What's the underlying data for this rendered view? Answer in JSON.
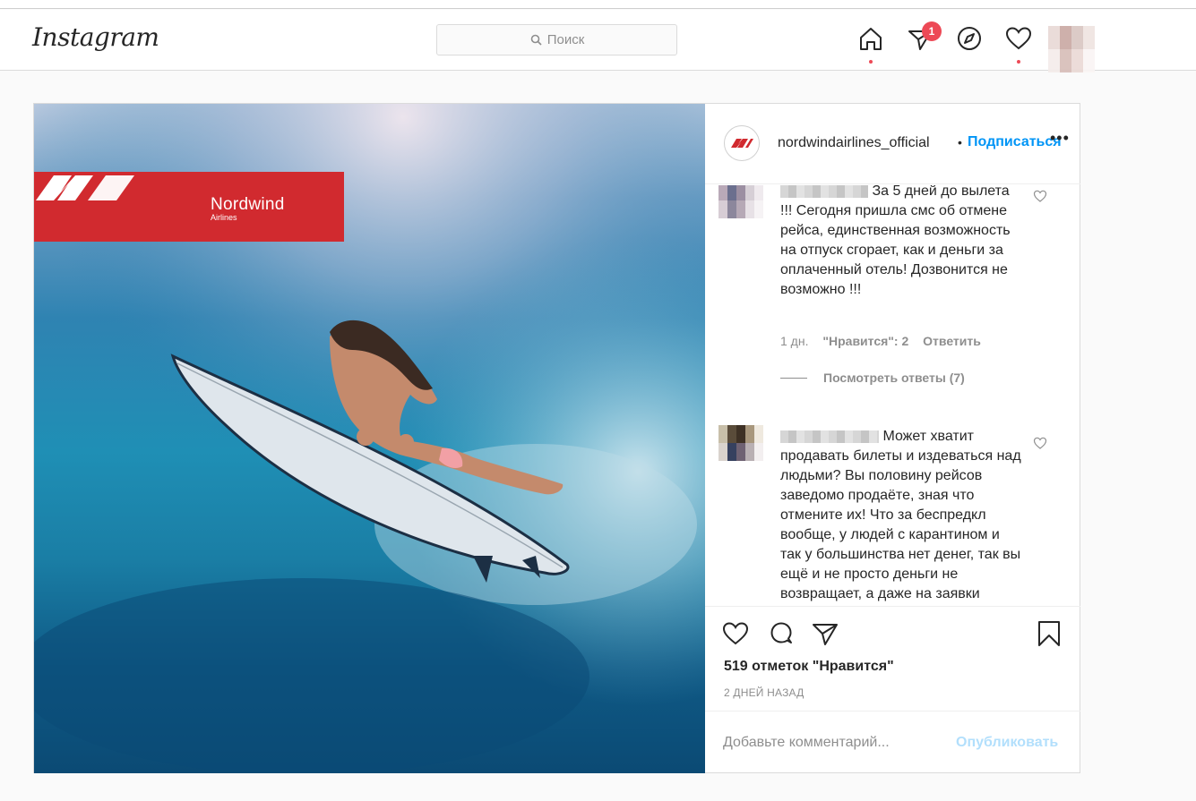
{
  "navbar": {
    "logo": "Instagram",
    "search_placeholder": "Поиск",
    "direct_badge": "1"
  },
  "post": {
    "brand": {
      "name": "Nordwind",
      "sub": "Airlines",
      "color": "#d12a2f"
    },
    "account": {
      "username": "nordwindairlines_official",
      "separator": "•",
      "follow_label": "Подписаться",
      "more_label": "•••"
    },
    "comments": [
      {
        "text": "За 5 дней до вылета !!! Сегодня пришла смс об отмене рейса, единственная возможность на отпуск сгорает, как и деньги за оплаченный отель! Дозвонится не возможно !!!",
        "age": "1 дн.",
        "likes": "\"Нравится\": 2",
        "reply_label": "Ответить",
        "view_replies": "Посмотреть ответы (7)"
      },
      {
        "text": "Может хватит продавать билеты и издеваться над людьми? Вы половину рейсов заведомо продаёте, зная что отмените их! Что за беспредкл вообще, у людей с карантином и так у большинства нет денег, так вы ещё и не просто деньги не возвращает, а даже на заявки"
      }
    ],
    "likes_count": "519 отметок \"Нравится\"",
    "timestamp": "2 ДНЕЙ НАЗАД",
    "comment_placeholder": "Добавьте комментарий...",
    "publish_label": "Опубликовать"
  },
  "colors": {
    "accent": "#0095f6",
    "notification": "#ed4956",
    "publish_disabled": "#b2dffc"
  }
}
